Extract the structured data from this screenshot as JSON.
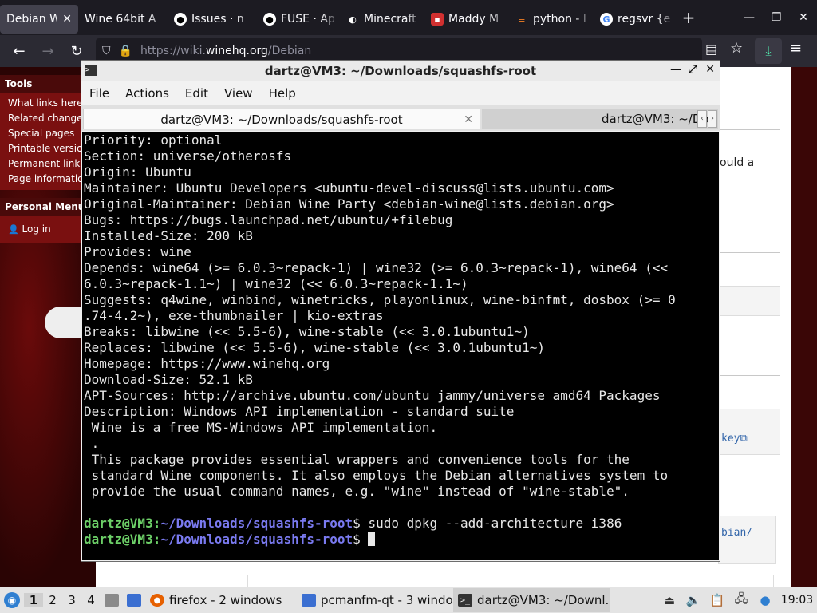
{
  "browser": {
    "tabs": [
      {
        "label": "Debian Wi",
        "icon": "wine-icon",
        "active": true
      },
      {
        "label": "Wine 64bit A",
        "icon": "wine-icon"
      },
      {
        "label": "Issues · n",
        "icon": "github-icon"
      },
      {
        "label": "FUSE · Ap",
        "icon": "github-icon"
      },
      {
        "label": "Minecraft",
        "icon": "minecraft-icon"
      },
      {
        "label": "Maddy M",
        "icon": "maddy-icon"
      },
      {
        "label": "python - l",
        "icon": "stackoverflow-icon"
      },
      {
        "label": "regsvr {e",
        "icon": "google-icon"
      }
    ],
    "new_tab": "+",
    "url": {
      "prefix": "https://wiki.",
      "domain": "winehq.org",
      "path": "/Debian"
    }
  },
  "wiki": {
    "tools_heading": "Tools",
    "tools": [
      "What links here",
      "Related changes",
      "Special pages",
      "Printable version",
      "Permanent link",
      "Page information"
    ],
    "personal_heading": "Personal Menu",
    "login": "Log in",
    "fragments": {
      "ould_a": "ould a",
      "key_link": "key",
      "debian_link": "bian/"
    }
  },
  "terminal": {
    "title": "dartz@VM3: ~/Downloads/squashfs-root",
    "menu": [
      "File",
      "Actions",
      "Edit",
      "View",
      "Help"
    ],
    "tabs": [
      {
        "label": "dartz@VM3: ~/Downloads/squashfs-root",
        "active": true
      },
      {
        "label": "dartz@VM3: ~/Do"
      }
    ],
    "output": [
      "Priority: optional",
      "Section: universe/otherosfs",
      "Origin: Ubuntu",
      "Maintainer: Ubuntu Developers <ubuntu-devel-discuss@lists.ubuntu.com>",
      "Original-Maintainer: Debian Wine Party <debian-wine@lists.debian.org>",
      "Bugs: https://bugs.launchpad.net/ubuntu/+filebug",
      "Installed-Size: 200 kB",
      "Provides: wine",
      "Depends: wine64 (>= 6.0.3~repack-1) | wine32 (>= 6.0.3~repack-1), wine64 (<<",
      "6.0.3~repack-1.1~) | wine32 (<< 6.0.3~repack-1.1~)",
      "Suggests: q4wine, winbind, winetricks, playonlinux, wine-binfmt, dosbox (>= 0",
      ".74-4.2~), exe-thumbnailer | kio-extras",
      "Breaks: libwine (<< 5.5-6), wine-stable (<< 3.0.1ubuntu1~)",
      "Replaces: libwine (<< 5.5-6), wine-stable (<< 3.0.1ubuntu1~)",
      "Homepage: https://www.winehq.org",
      "Download-Size: 52.1 kB",
      "APT-Sources: http://archive.ubuntu.com/ubuntu jammy/universe amd64 Packages",
      "Description: Windows API implementation - standard suite",
      " Wine is a free MS-Windows API implementation.",
      " .",
      " This package provides essential wrappers and convenience tools for the",
      " standard Wine components. It also employs the Debian alternatives system to",
      " provide the usual command names, e.g. \"wine\" instead of \"wine-stable\".",
      ""
    ],
    "prompt_user": "dartz@VM3",
    "prompt_sep": ":",
    "prompt_path": "~/Downloads/squashfs-root",
    "prompt_end": "$",
    "command1": " sudo dpkg --add-architecture i386",
    "command2": " "
  },
  "taskbar": {
    "desktops": [
      "1",
      "2",
      "3",
      "4"
    ],
    "tasks": [
      {
        "label": "firefox - 2 windows",
        "icon": "firefox-icon"
      },
      {
        "label": "pcmanfm-qt - 3 windo...",
        "icon": "folder-icon"
      },
      {
        "label": "dartz@VM3: ~/Downl...",
        "icon": "terminal-icon",
        "active": true
      }
    ],
    "clock": "19:03"
  }
}
